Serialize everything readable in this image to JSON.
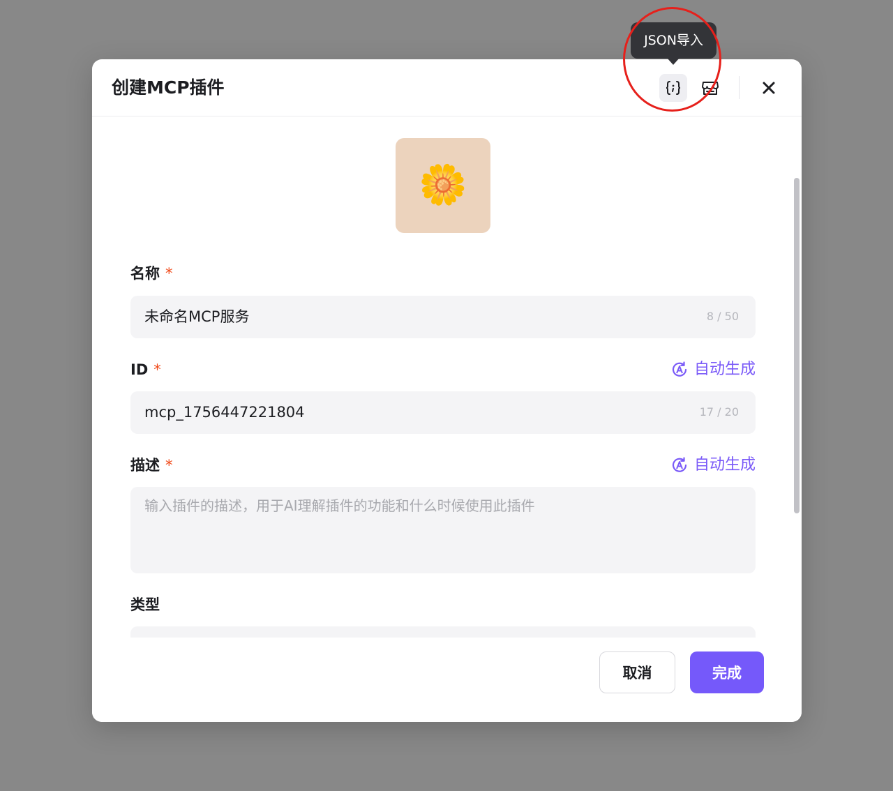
{
  "dialog": {
    "title": "创建MCP插件",
    "tooltip": "JSON导入",
    "close_icon": "close-icon",
    "json_icon": "json-braces-icon",
    "store_icon": "store-icon"
  },
  "avatar": {
    "emoji": "🌼",
    "bg_color": "#ecd3bd"
  },
  "form": {
    "name": {
      "label": "名称",
      "required_mark": "*",
      "value": "未命名MCP服务",
      "counter": "8 / 50"
    },
    "id": {
      "label": "ID",
      "required_mark": "*",
      "value": "mcp_1756447221804",
      "counter": "17 / 20",
      "autogen_label": "自动生成"
    },
    "description": {
      "label": "描述",
      "required_mark": "*",
      "placeholder": "输入插件的描述，用于AI理解插件的功能和什么时候使用此插件",
      "autogen_label": "自动生成"
    },
    "type": {
      "label": "类型"
    }
  },
  "footer": {
    "cancel_label": "取消",
    "done_label": "完成"
  },
  "colors": {
    "accent": "#7559fa",
    "required": "#f04a1a",
    "annotation": "#e6201b"
  }
}
